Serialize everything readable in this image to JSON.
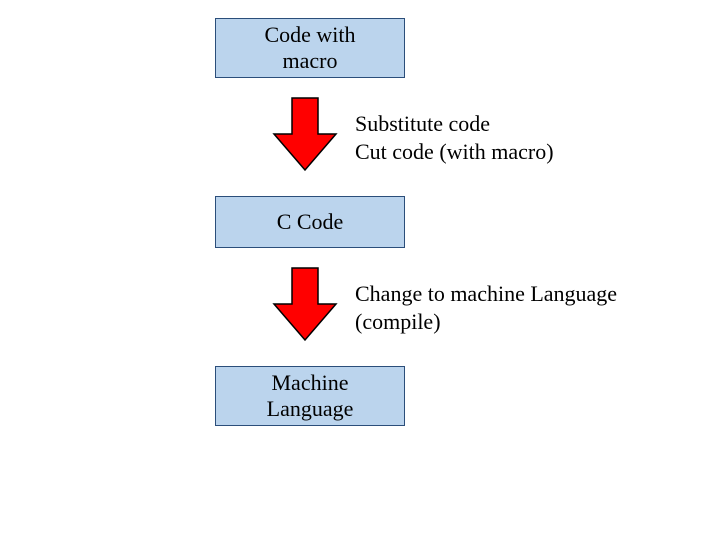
{
  "boxes": {
    "code_with_macro": "Code with\nmacro",
    "c_code": "C Code",
    "machine_language": "Machine\nLanguage"
  },
  "labels": {
    "substitute": "Substitute code\nCut code (with macro)",
    "compile": "Change to machine Language\n(compile)"
  },
  "colors": {
    "box_fill": "#bbd4ed",
    "box_border": "#2b4e7a",
    "arrow_fill": "#ff0000",
    "arrow_stroke": "#000000"
  }
}
